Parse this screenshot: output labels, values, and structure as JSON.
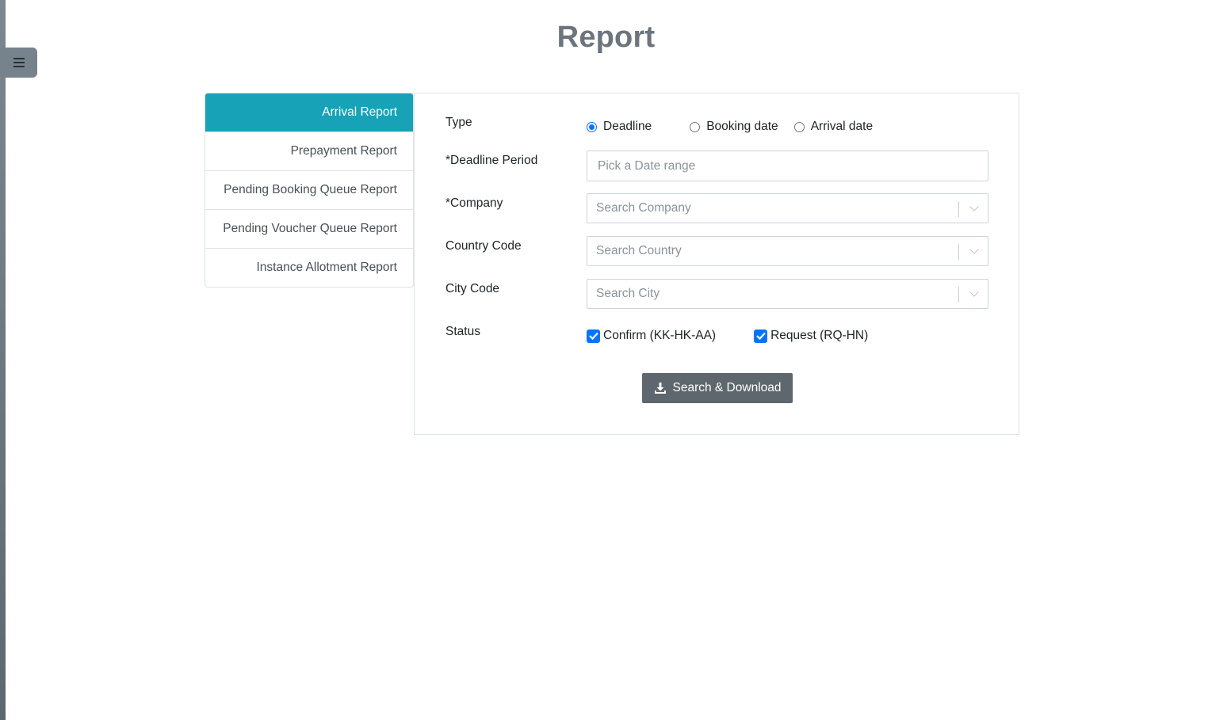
{
  "page": {
    "title": "Report"
  },
  "sidebar_toggle": {
    "icon": "hamburger-icon"
  },
  "tabs": [
    {
      "label": "Arrival Report",
      "active": true
    },
    {
      "label": "Prepayment Report",
      "active": false
    },
    {
      "label": "Pending Booking Queue Report",
      "active": false
    },
    {
      "label": "Pending Voucher Queue Report",
      "active": false
    },
    {
      "label": "Instance Allotment Report",
      "active": false
    }
  ],
  "form": {
    "type": {
      "label": "Type",
      "options": [
        {
          "label": "Deadline",
          "checked": true
        },
        {
          "label": "Booking date",
          "checked": false
        },
        {
          "label": "Arrival date",
          "checked": false
        }
      ]
    },
    "deadline_period": {
      "label": "*Deadline Period",
      "placeholder": "Pick a Date range",
      "value": ""
    },
    "company": {
      "label": "*Company",
      "placeholder": "Search Company",
      "value": ""
    },
    "country_code": {
      "label": "Country Code",
      "placeholder": "Search Country",
      "value": ""
    },
    "city_code": {
      "label": "City Code",
      "placeholder": "Search City",
      "value": ""
    },
    "status": {
      "label": "Status",
      "options": [
        {
          "label": "Confirm (KK-HK-AA)",
          "checked": true
        },
        {
          "label": "Request (RQ-HN)",
          "checked": true
        }
      ]
    },
    "submit": {
      "label": "Search & Download",
      "icon": "download-icon"
    }
  },
  "colors": {
    "tab_active": "#17a2b8",
    "button": "#5f676e",
    "checkbox": "#0075ff",
    "title": "#6c757d"
  }
}
